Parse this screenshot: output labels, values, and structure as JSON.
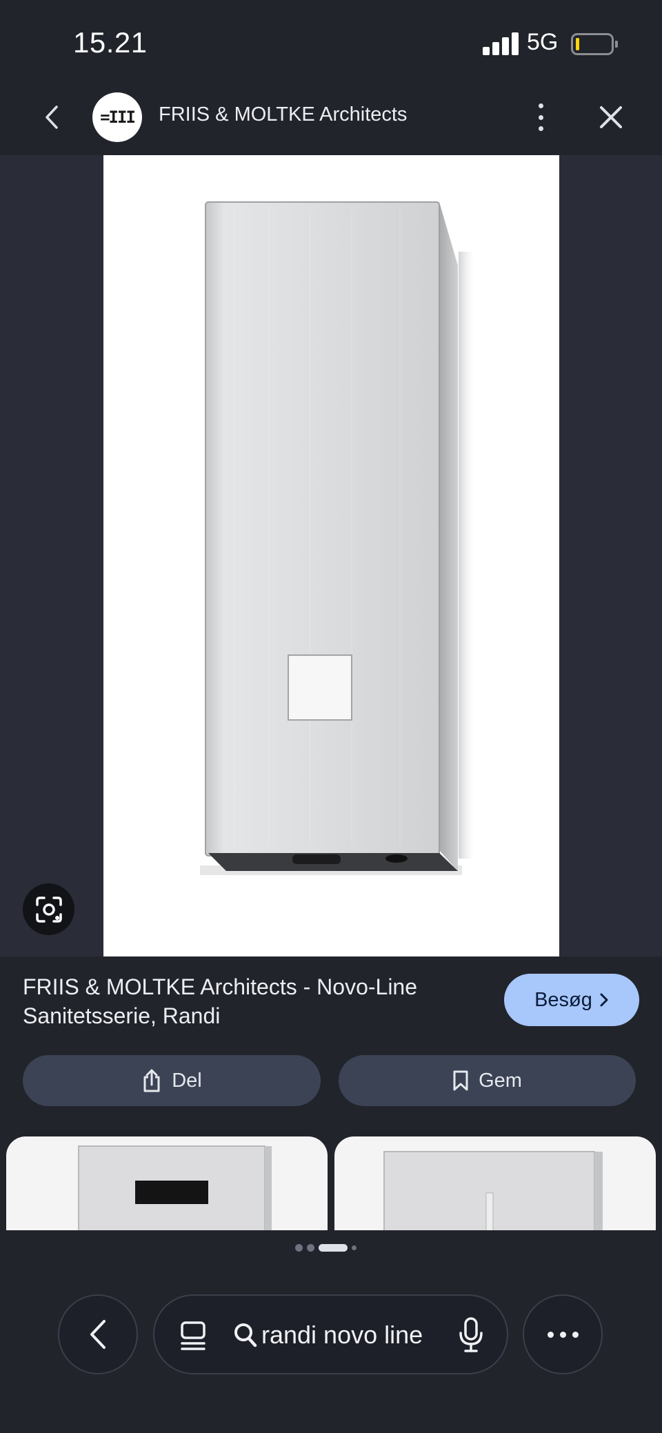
{
  "status_bar": {
    "time": "15.21",
    "network": "5G"
  },
  "app_bar": {
    "site_logo_text": "=III",
    "site_title": "FRIIS & MOLTKE Architects"
  },
  "result": {
    "title": "FRIIS & MOLTKE Architects - Novo-Line Sanitetsserie, Randi",
    "visit_label": "Besøg",
    "share_label": "Del",
    "save_label": "Gem"
  },
  "pager": {
    "count": 4,
    "active_index": 2
  },
  "bottom_bar": {
    "search_query": "randi novo line"
  },
  "colors": {
    "background": "#22242c",
    "visit_button": "#a8c7fa",
    "pill_button": "#3b4354",
    "battery_level": "#ffd60a"
  },
  "icons": [
    "back-icon",
    "more-vert-icon",
    "close-icon",
    "lens-icon",
    "share-icon",
    "bookmark-icon",
    "chevron-right-icon",
    "tabs-icon",
    "search-icon",
    "mic-icon",
    "more-horiz-icon"
  ]
}
